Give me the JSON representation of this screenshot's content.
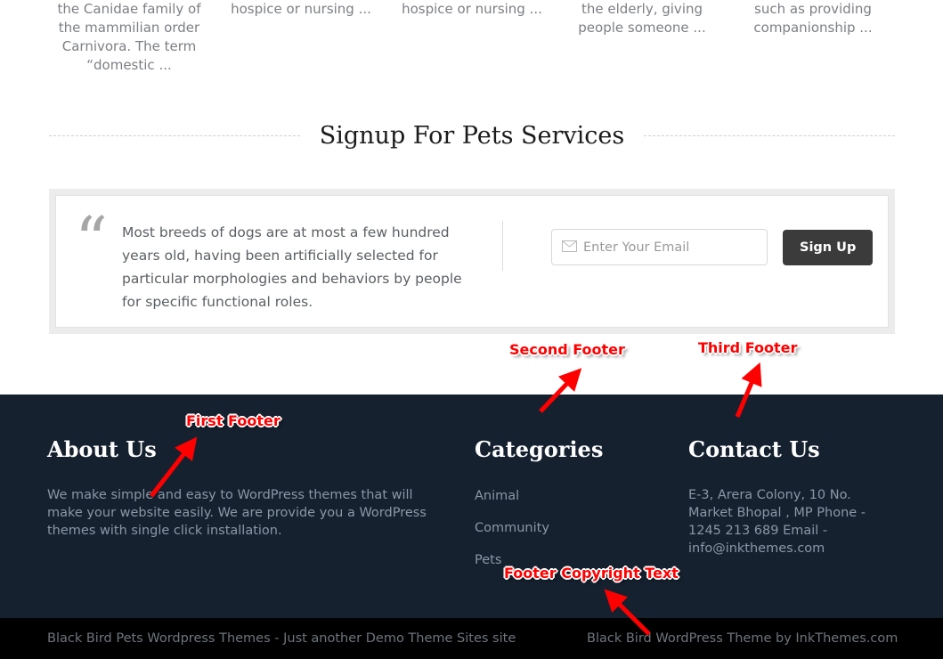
{
  "excerpts": [
    "the Canidae family of the mammilian order Carnivora. The term “domestic ...",
    "hospice or nursing ...",
    "hospice or nursing ...",
    "the elderly, giving people someone ...",
    "such as providing companionship ..."
  ],
  "signup": {
    "heading": "Signup For Pets Services",
    "quote_mark": "“",
    "quote_text": "Most breeds of dogs are at most a few hundred years old, having been artificially selected for particular morphologies and behaviors by people for specific functional roles.",
    "email_placeholder": "Enter Your Email",
    "email_value": "",
    "email_icon": "envelope-icon",
    "button_label": "Sign Up",
    "button_color": "#3b3b3b"
  },
  "footer": {
    "background": "#16212f",
    "about": {
      "title": "About Us",
      "text": "We make simple and easy to WordPress themes that will make your website easily. We are provide you a WordPress themes with single click installation."
    },
    "categories": {
      "title": "Categories",
      "items": [
        "Animal",
        "Community",
        "Pets"
      ]
    },
    "contact": {
      "title": "Contact Us",
      "text": "E-3, Arera Colony, 10 No. Market Bhopal , MP Phone - 1245 213 689 Email - info@inkthemes.com"
    }
  },
  "copyright": {
    "background": "#000000",
    "left": "Black Bird Pets Wordpress Themes - Just another Demo Theme Sites site",
    "right": "Black Bird WordPress Theme by InkThemes.com"
  },
  "annotations": {
    "color": "#ff0000",
    "first_footer": "First Footer",
    "second_footer": "Second Footer",
    "third_footer": "Third Footer",
    "footer_copyright": "Footer Copyright Text"
  }
}
